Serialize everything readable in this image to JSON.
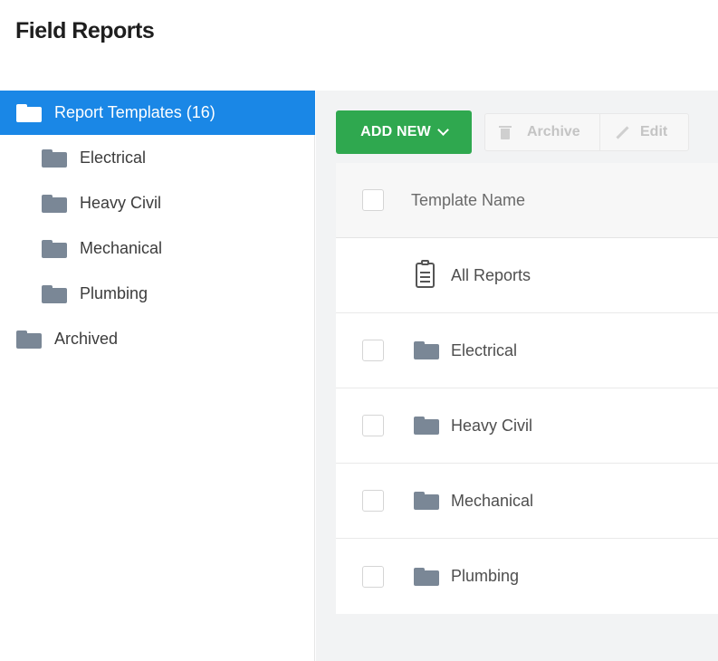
{
  "header": {
    "title": "Field Reports"
  },
  "sidebar": {
    "items": [
      {
        "label": "Report Templates (16)"
      },
      {
        "label": "Electrical"
      },
      {
        "label": "Heavy Civil"
      },
      {
        "label": "Mechanical"
      },
      {
        "label": "Plumbing"
      },
      {
        "label": "Archived"
      }
    ]
  },
  "toolbar": {
    "add_new_label": "ADD NEW",
    "archive_label": "Archive",
    "edit_label": "Edit"
  },
  "table": {
    "column_header": "Template Name",
    "rows": [
      {
        "label": "All Reports",
        "icon": "clipboard-icon"
      },
      {
        "label": "Electrical",
        "icon": "folder-icon"
      },
      {
        "label": "Heavy Civil",
        "icon": "folder-icon"
      },
      {
        "label": "Mechanical",
        "icon": "folder-icon"
      },
      {
        "label": "Plumbing",
        "icon": "folder-icon"
      }
    ]
  },
  "colors": {
    "active_blue": "#1a87e6",
    "add_green": "#2fa84f",
    "folder_grey": "#7a8796"
  }
}
